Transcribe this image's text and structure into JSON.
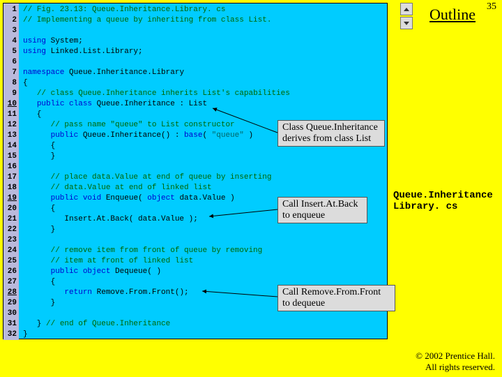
{
  "page_number": "35",
  "outline_label": "Outline",
  "filename_lines": [
    "Queue.Inheritance",
    "Library. cs"
  ],
  "copyright": [
    "© 2002 Prentice Hall.",
    "All rights reserved."
  ],
  "line_numbers": [
    "1",
    "2",
    "3",
    "4",
    "5",
    "6",
    "7",
    "8",
    "9",
    "10",
    "11",
    "12",
    "13",
    "14",
    "15",
    "16",
    "17",
    "18",
    "19",
    "20",
    "21",
    "22",
    "23",
    "24",
    "25",
    "26",
    "27",
    "28",
    "29",
    "30",
    "31",
    "32"
  ],
  "underlined_lines": [
    "10",
    "19",
    "28"
  ],
  "callouts": {
    "c1": "Class Queue.Inheritance derives from class List",
    "c2": "Call Insert.At.Back to enqueue",
    "c3": "Call Remove.From.Front to dequeue"
  },
  "code": {
    "l1": {
      "cls": "c",
      "t": "// Fig. 23.13: Queue.Inheritance.Library. cs"
    },
    "l2": {
      "cls": "c",
      "t": "// Implementing a queue by inheriting from class List."
    },
    "l3": {
      "cls": "",
      "t": ""
    },
    "l4": {
      "cls": "",
      "t": "<span class='k'>using</span> System;"
    },
    "l5": {
      "cls": "",
      "t": "<span class='k'>using</span> Linked.List.Library;"
    },
    "l6": {
      "cls": "",
      "t": ""
    },
    "l7": {
      "cls": "",
      "t": "<span class='k'>namespace</span> Queue.Inheritance.Library"
    },
    "l8": {
      "cls": "",
      "t": "{"
    },
    "l9": {
      "cls": "",
      "t": "   <span class='c'>// class Queue.Inheritance inherits List's capabilities</span>"
    },
    "l10": {
      "cls": "",
      "t": "   <span class='k'>public class</span> Queue.Inheritance : List"
    },
    "l11": {
      "cls": "",
      "t": "   {"
    },
    "l12": {
      "cls": "",
      "t": "      <span class='c'>// pass name \"queue\" to List constructor</span>"
    },
    "l13": {
      "cls": "",
      "t": "      <span class='k'>public</span> Queue.Inheritance() : <span class='k'>base</span>( <span class='s'>\"queue\"</span> )"
    },
    "l14": {
      "cls": "",
      "t": "      {"
    },
    "l15": {
      "cls": "",
      "t": "      }"
    },
    "l16": {
      "cls": "",
      "t": ""
    },
    "l17": {
      "cls": "",
      "t": "      <span class='c'>// place data.Value at end of queue by inserting</span>"
    },
    "l18": {
      "cls": "",
      "t": "      <span class='c'>// data.Value at end of linked list</span>"
    },
    "l19": {
      "cls": "",
      "t": "      <span class='k'>public void</span> Enqueue( <span class='k'>object</span> data.Value )"
    },
    "l20": {
      "cls": "",
      "t": "      {"
    },
    "l21": {
      "cls": "",
      "t": "         Insert.At.Back( data.Value );"
    },
    "l22": {
      "cls": "",
      "t": "      }"
    },
    "l23": {
      "cls": "",
      "t": ""
    },
    "l24": {
      "cls": "",
      "t": "      <span class='c'>// remove item from front of queue by removing</span>"
    },
    "l25": {
      "cls": "",
      "t": "      <span class='c'>// item at front of linked list</span>"
    },
    "l26": {
      "cls": "",
      "t": "      <span class='k'>public object</span> Dequeue( )"
    },
    "l27": {
      "cls": "",
      "t": "      {"
    },
    "l28": {
      "cls": "",
      "t": "         <span class='k'>return</span> Remove.From.Front();"
    },
    "l29": {
      "cls": "",
      "t": "      }"
    },
    "l30": {
      "cls": "",
      "t": ""
    },
    "l31": {
      "cls": "",
      "t": "   } <span class='c'>// end of Queue.Inheritance</span>"
    },
    "l32": {
      "cls": "",
      "t": "}"
    }
  }
}
